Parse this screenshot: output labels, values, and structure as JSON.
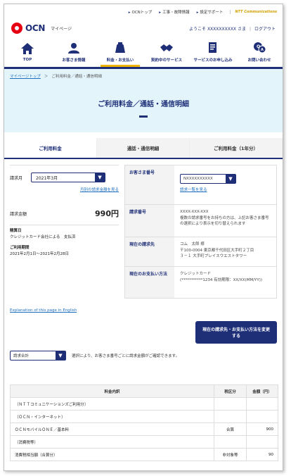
{
  "topbar": {
    "links": [
      "OCNトップ",
      "工事・故障情報",
      "設定サポート"
    ],
    "ntt": "NTT Communications"
  },
  "brand": {
    "logo": "OCN",
    "sub": "マイページ",
    "welcome": "ようこそ XXXXXXXXXX さま",
    "logout": "ログアウト"
  },
  "nav": [
    {
      "label": "TOP",
      "icon": "home-icon"
    },
    {
      "label": "お客さま情報",
      "icon": "user-icon"
    },
    {
      "label": "料金・お支払い",
      "icon": "wallet-icon"
    },
    {
      "label": "契約中のサービス",
      "icon": "handshake-icon"
    },
    {
      "label": "サービスのお申し込み",
      "icon": "document-icon"
    },
    {
      "label": "お問い合わせ",
      "icon": "qa-icon"
    }
  ],
  "crumbs": {
    "home": "マイページトップ",
    "current": "ご利用料金／通話・通信明細"
  },
  "title": "ご利用料金／通話・通信明細",
  "tabs": [
    "ご利用料金",
    "通話・通信明細",
    "ご利用料金（1年分）"
  ],
  "left": {
    "month_label": "請求月",
    "month_value": "2021年3月",
    "other_link": "月別の請求金額を見る",
    "amount_label": "請求金額",
    "amount": "990円",
    "settle_label": "精算日",
    "settle_value": "クレジットカード会社による　支払済",
    "period_label": "ご利用期間",
    "period_value": "2021年2月1日〜2021年2月28日"
  },
  "right": {
    "cust_label": "お客さま番号",
    "cust_value": "NXXXXXXXXXX",
    "cust_link": "請求一覧を見る",
    "billno_label": "請求番号",
    "billno_value": "XXXX-XXX-XXX",
    "billno_note": "複数の請求番号をお持ちの方は、上記お客さま番号の選択により表示を切り替えられます",
    "addr_label": "現在の請求先",
    "addr_name": "コム　太郎 様",
    "addr_line1": "〒100-0004 東京都千代田区大手町２丁目",
    "addr_line2": "３－１ 大手町プレイスウエストタワー",
    "pay_label": "現在のお支払い方法",
    "pay_value": "クレジットカード",
    "pay_card": "(***********1234 有効期限：XX/XX(MM/YY))"
  },
  "english_link": "Explanation of this page in English",
  "change_button": "現在の請求先・お支払い方法を変更する",
  "filter": {
    "select": "請求合計",
    "note": "選択により、お客さま番号ごとに請求金額がご確認できます。"
  },
  "table": {
    "headers": [
      "料金内訳",
      "税区分",
      "金額（円）"
    ],
    "rows": [
      [
        "〔ＮＴＴコミュニケーションズご利用分〕",
        "",
        ""
      ],
      [
        "〔ＯＣＮ・インターネット〕",
        "",
        ""
      ],
      [
        "ＯＣＮモバイルＯＮＥ／基本料",
        "合算",
        "900"
      ],
      [
        "〔消費税等〕",
        "",
        ""
      ],
      [
        "消費税相当額（合算分）",
        "非対象等",
        "90"
      ]
    ]
  }
}
